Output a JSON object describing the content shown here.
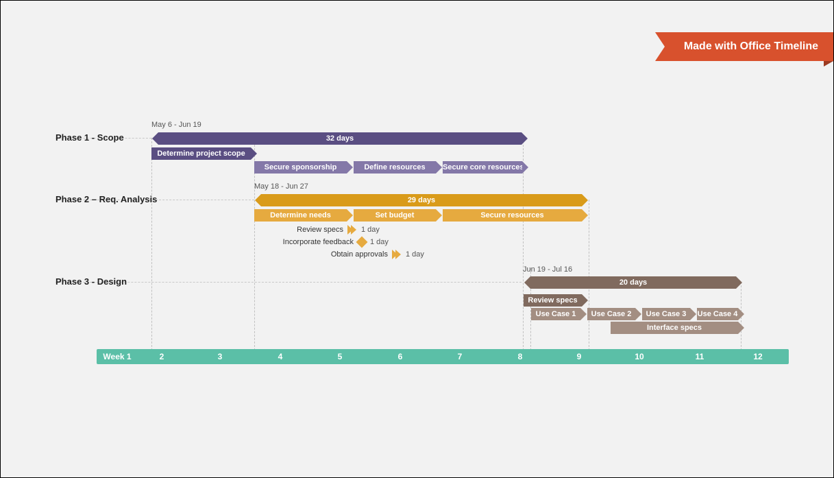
{
  "ribbon": {
    "label": "Made with Office Timeline"
  },
  "rows": {
    "phase1": {
      "label": "Phase 1 - Scope",
      "range": "May 6 - Jun 19"
    },
    "phase2": {
      "label": "Phase 2 – Req. Analysis",
      "range": "May 18 - Jun 27"
    },
    "phase3": {
      "label": "Phase 3 - Design",
      "range": "Jun 19 - Jul 16"
    }
  },
  "bars": {
    "p1_summary": "32 days",
    "p1_a": "Determine project scope",
    "p1_b": "Secure sponsorship",
    "p1_c": "Define resources",
    "p1_d": "Secure core resources",
    "p2_summary": "29 days",
    "p2_a": "Determine needs",
    "p2_b": "Set budget",
    "p2_c": "Secure resources",
    "p3_summary": "20 days",
    "p3_a": "Review specs",
    "p3_b": "Use Case 1",
    "p3_c": "Use Case 2",
    "p3_d": "Use Case 3",
    "p3_e": "Use Case 4",
    "p3_f": "Interface specs"
  },
  "milestones": {
    "m1": {
      "label": "Review specs",
      "dur": "1 day"
    },
    "m2": {
      "label": "Incorporate feedback",
      "dur": "1 day"
    },
    "m3": {
      "label": "Obtain approvals",
      "dur": "1 day"
    }
  },
  "axis": {
    "ticks": [
      "Week 1",
      "2",
      "3",
      "4",
      "5",
      "6",
      "7",
      "8",
      "9",
      "10",
      "11",
      "12"
    ]
  },
  "chart_data": {
    "type": "bar",
    "title": "",
    "xlabel": "Week",
    "ylabel": "",
    "x_ticks": [
      1,
      2,
      3,
      4,
      5,
      6,
      7,
      8,
      9,
      10,
      11,
      12
    ],
    "phases": [
      {
        "name": "Phase 1 - Scope",
        "range": "May 6 - Jun 19",
        "start_week": 1,
        "end_week": 8,
        "duration_days": 32,
        "tasks": [
          {
            "name": "Determine project scope",
            "start_week": 1.0,
            "end_week": 3.0
          },
          {
            "name": "Secure sponsorship",
            "start_week": 2.9,
            "end_week": 4.7
          },
          {
            "name": "Define resources",
            "start_week": 4.7,
            "end_week": 6.2
          },
          {
            "name": "Secure core resources",
            "start_week": 6.2,
            "end_week": 8.0
          }
        ]
      },
      {
        "name": "Phase 2 – Req. Analysis",
        "range": "May 18 - Jun 27",
        "start_week": 3.0,
        "end_week": 9.0,
        "duration_days": 29,
        "tasks": [
          {
            "name": "Determine needs",
            "start_week": 3.0,
            "end_week": 4.7
          },
          {
            "name": "Set budget",
            "start_week": 4.7,
            "end_week": 6.2
          },
          {
            "name": "Secure resources",
            "start_week": 6.2,
            "end_week": 9.0
          }
        ],
        "milestones": [
          {
            "name": "Review specs",
            "week": 4.6,
            "duration": "1 day"
          },
          {
            "name": "Incorporate feedback",
            "week": 4.7,
            "duration": "1 day"
          },
          {
            "name": "Obtain approvals",
            "week": 5.4,
            "duration": "1 day"
          }
        ]
      },
      {
        "name": "Phase 3 - Design",
        "range": "Jun 19 - Jul 16",
        "start_week": 8.1,
        "end_week": 12.0,
        "duration_days": 20,
        "tasks": [
          {
            "name": "Review specs",
            "start_week": 8.05,
            "end_week": 9.0
          },
          {
            "name": "Use Case 1",
            "start_week": 8.15,
            "end_week": 9.0
          },
          {
            "name": "Use Case 2",
            "start_week": 9.0,
            "end_week": 10.0
          },
          {
            "name": "Use Case 3",
            "start_week": 10.0,
            "end_week": 11.0
          },
          {
            "name": "Use Case 4",
            "start_week": 11.0,
            "end_week": 12.0
          },
          {
            "name": "Interface specs",
            "start_week": 9.4,
            "end_week": 12.0
          }
        ]
      }
    ]
  }
}
